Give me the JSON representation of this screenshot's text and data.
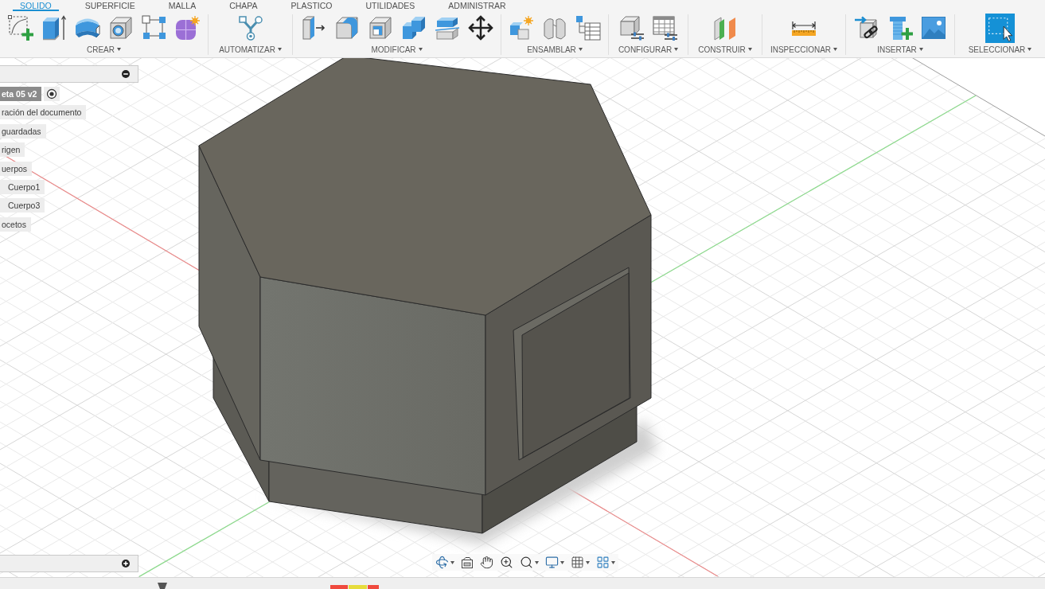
{
  "tabs": [
    {
      "label": "SOLIDO",
      "selected": true
    },
    {
      "label": "SUPERFICIE",
      "selected": false
    },
    {
      "label": "MALLA",
      "selected": false
    },
    {
      "label": "CHAPA",
      "selected": false
    },
    {
      "label": "PLASTICO",
      "selected": false
    },
    {
      "label": "UTILIDADES",
      "selected": false
    },
    {
      "label": "ADMINISTRAR",
      "selected": false
    }
  ],
  "toolbar": {
    "groups": [
      {
        "label": "CREAR"
      },
      {
        "label": "AUTOMATIZAR"
      },
      {
        "label": "MODIFICAR"
      },
      {
        "label": "ENSAMBLAR"
      },
      {
        "label": "CONFIGURAR"
      },
      {
        "label": "CONSTRUIR"
      },
      {
        "label": "INSPECCIONAR"
      },
      {
        "label": "INSERTAR"
      },
      {
        "label": "SELECCIONAR"
      }
    ]
  },
  "browser": {
    "tree": [
      {
        "label": "eta 05 v2",
        "active": true
      },
      {
        "label": "ración del documento",
        "active": false
      },
      {
        "label": "guardadas",
        "active": false
      },
      {
        "label": "rigen",
        "active": false
      },
      {
        "label": "uerpos",
        "active": false,
        "children": [
          {
            "label": "Cuerpo1",
            "active": false
          },
          {
            "label": "Cuerpo3",
            "active": false
          }
        ]
      },
      {
        "label": "ocetos",
        "active": false
      }
    ]
  }
}
